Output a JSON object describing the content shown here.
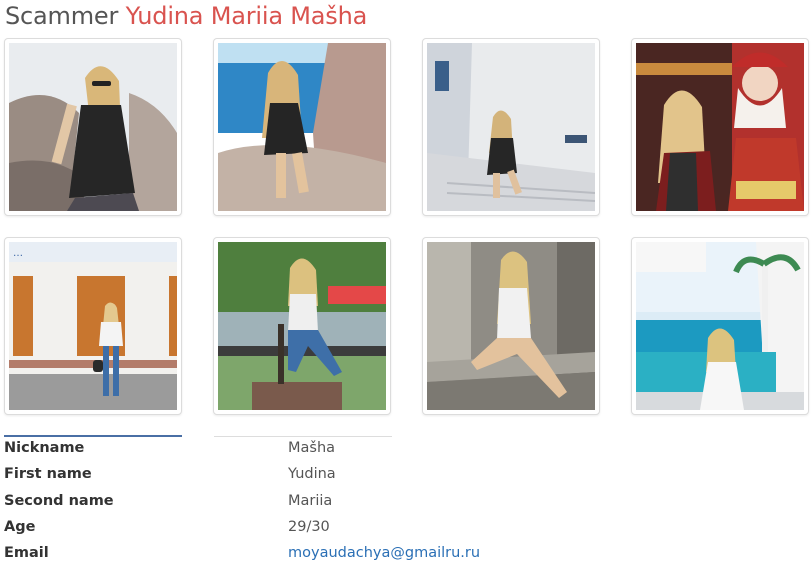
{
  "header": {
    "prefix": "Scammer",
    "name": "Yudina Mariia Mašha"
  },
  "gallery": {
    "photos": [
      {
        "subject": "woman in black dress on rocky coast"
      },
      {
        "subject": "woman sitting on rocks by blue sea"
      },
      {
        "subject": "woman sitting on white stairs"
      },
      {
        "subject": "woman with Santa Claus statue"
      },
      {
        "subject": "woman standing in front of shuttered building"
      },
      {
        "subject": "woman sitting on statue chair in park"
      },
      {
        "subject": "woman sitting on stone steps"
      },
      {
        "subject": "woman on turquoise sofa at seaside terrace"
      }
    ]
  },
  "profile": {
    "rows": [
      {
        "label": "Nickname",
        "value": "Mašha"
      },
      {
        "label": "First name",
        "value": "Yudina"
      },
      {
        "label": "Second name",
        "value": "Mariia"
      },
      {
        "label": "Age",
        "value": "29/30"
      },
      {
        "label": "Email",
        "value": "moyaudachya@gmailru.ru"
      }
    ]
  },
  "colors": {
    "title_name": "#d9534f",
    "link": "#2a6fb5",
    "accent_rule": "#4a6fa5"
  }
}
